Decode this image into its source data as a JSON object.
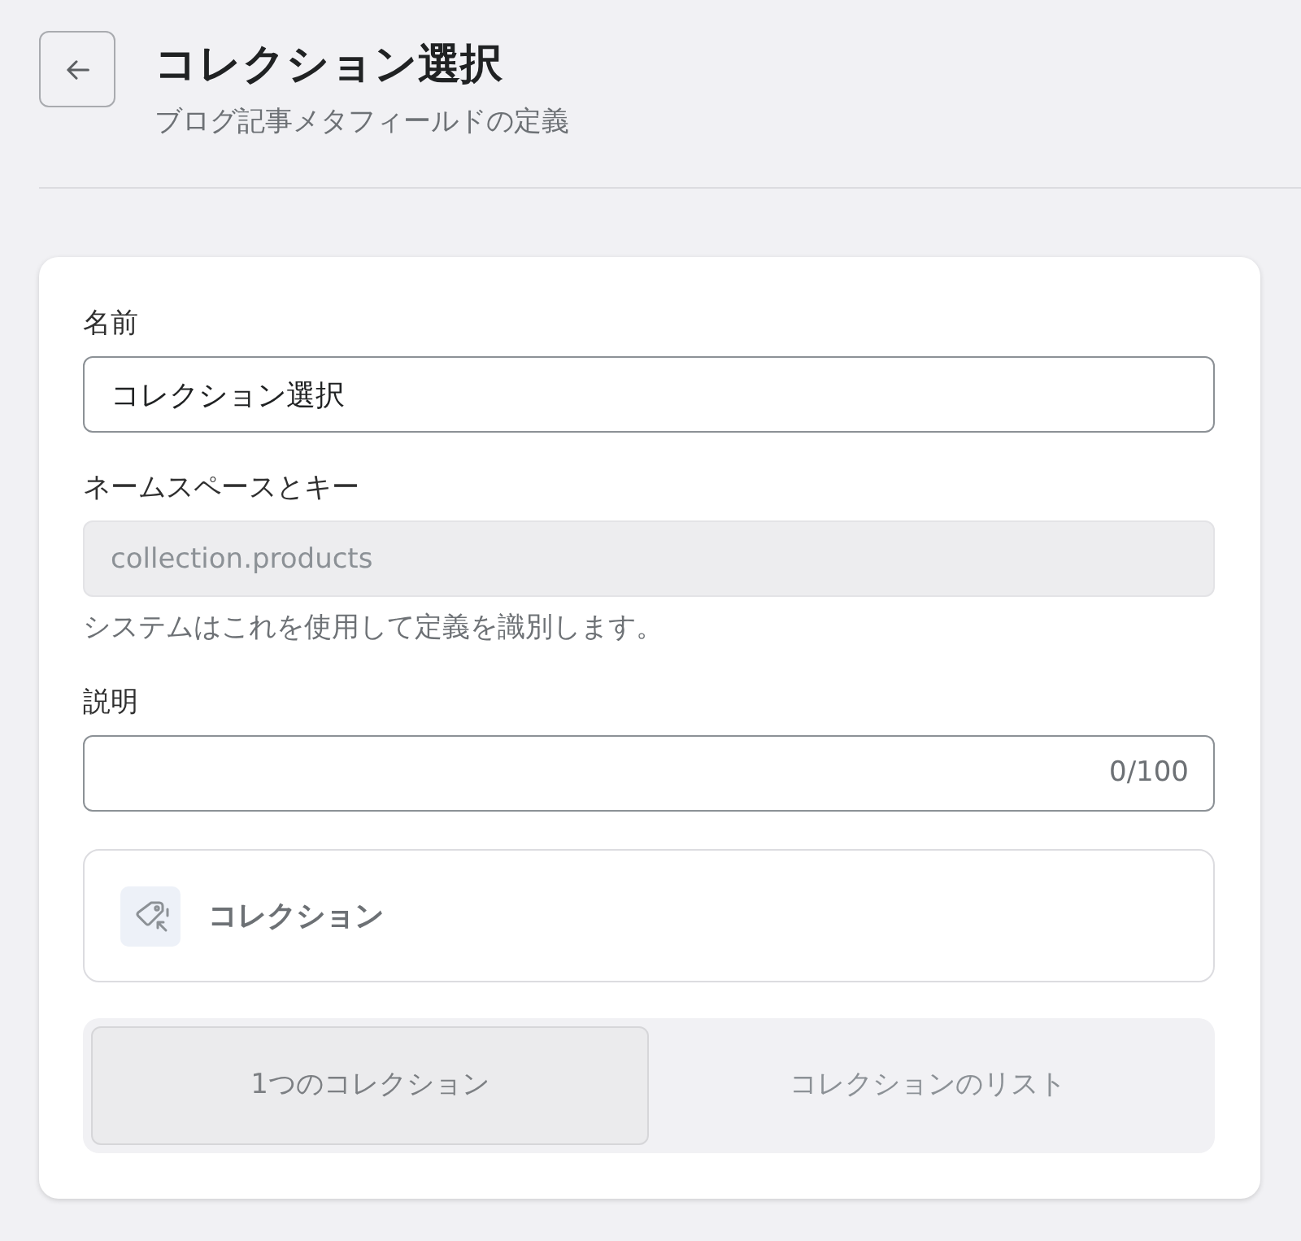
{
  "header": {
    "title": "コレクション選択",
    "subtitle": "ブログ記事メタフィールドの定義"
  },
  "fields": [
    {
      "kind": "text",
      "label": "名前",
      "value": "コレクション選択",
      "disabled": false
    },
    {
      "kind": "text",
      "label": "ネームスペースとキー",
      "value": "collection.products",
      "disabled": true,
      "help": "システムはこれを使用して定義を識別します。"
    },
    {
      "kind": "counter",
      "label": "説明",
      "counter": "0/100",
      "disabled": false
    }
  ],
  "type_card": {
    "label": "コレクション"
  },
  "options": [
    {
      "label": "1つのコレクション",
      "selected": true
    },
    {
      "label": "コレクションのリスト",
      "selected": false
    }
  ]
}
